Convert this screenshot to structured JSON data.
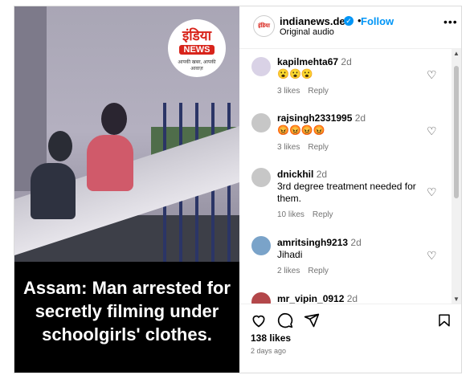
{
  "media": {
    "logo_hindi": "इंडिया",
    "logo_news": "NEWS",
    "logo_tagline": "आपकी खबर, आपकी आवाज़",
    "caption_lines": [
      "Assam: Man arrested for",
      "secretly filming under",
      "schoolgirls' clothes."
    ]
  },
  "header": {
    "username": "indianews.del",
    "verified": true,
    "follow_label": "Follow",
    "subtitle": "Original audio",
    "dot": "•",
    "more_icon": "more-horizontal-icon"
  },
  "comments": [
    {
      "user": "kapilmehta67",
      "time": "2d",
      "text": "😮😮😮",
      "likes": "3 likes",
      "reply": "Reply",
      "avatar_color": "#d9d2e6"
    },
    {
      "user": "rajsingh2331995",
      "time": "2d",
      "text": "😡😡😡😡",
      "likes": "3 likes",
      "reply": "Reply",
      "avatar_color": "#c7c7c7"
    },
    {
      "user": "dnickhil",
      "time": "2d",
      "text": "3rd degree treatment needed for them.",
      "likes": "10 likes",
      "reply": "Reply",
      "avatar_color": "#c7c7c7"
    },
    {
      "user": "amritsingh9213",
      "time": "2d",
      "text": "Jihadi",
      "likes": "2 likes",
      "reply": "Reply",
      "avatar_color": "#7aa3c9"
    },
    {
      "user": "mr_vipin_0912",
      "time": "2d",
      "text": "",
      "likes": "",
      "reply": "",
      "avatar_color": "#b3474a"
    }
  ],
  "footer": {
    "likes": "138 likes",
    "date": "2 days ago"
  },
  "colors": {
    "accent": "#0095f6",
    "brand_red": "#d8241b"
  }
}
